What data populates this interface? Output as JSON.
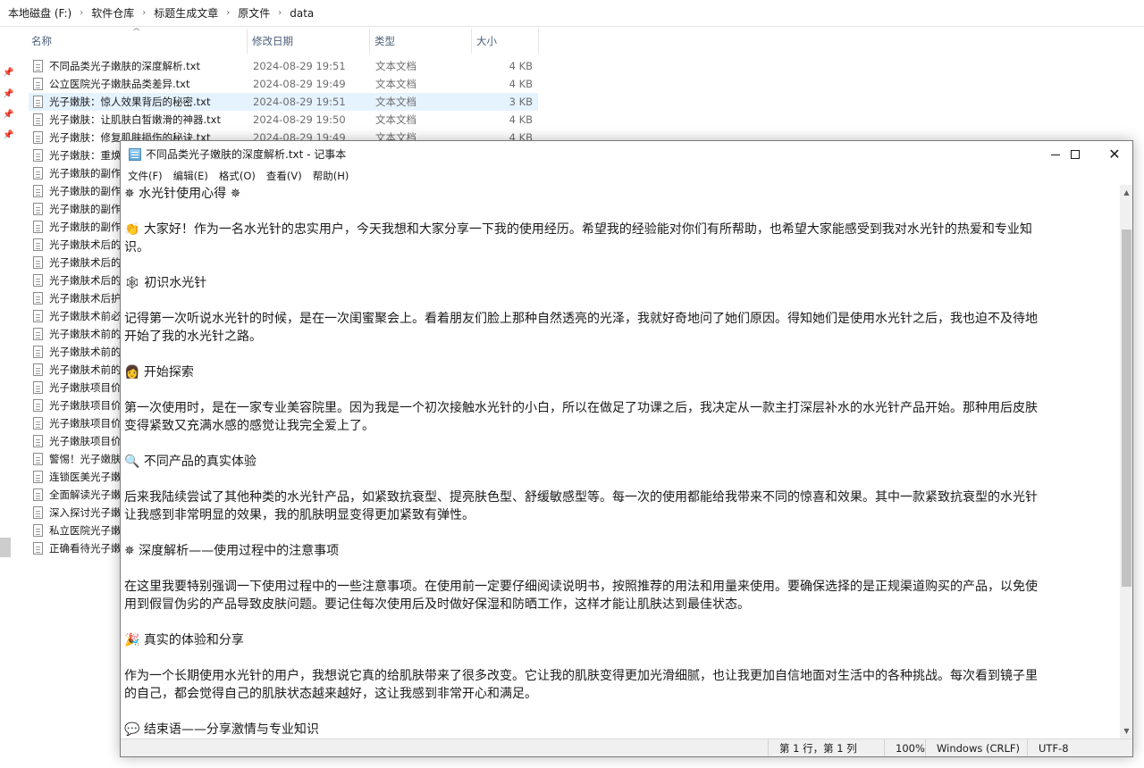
{
  "explorer": {
    "breadcrumb": [
      "本地磁盘 (F:)",
      "软件仓库",
      "标题生成文章",
      "原文件",
      "data"
    ],
    "breadcrumb_separator": "›",
    "columns": {
      "name": "名称",
      "date": "修改日期",
      "type": "类型",
      "size": "大小"
    },
    "files": [
      {
        "name": "不同品类光子嫩肤的深度解析.txt",
        "date": "2024-08-29 19:51",
        "type": "文本文档",
        "size": "4 KB"
      },
      {
        "name": "公立医院光子嫩肤品类差异.txt",
        "date": "2024-08-29 19:49",
        "type": "文本文档",
        "size": "4 KB"
      },
      {
        "name": "光子嫩肤：惊人效果背后的秘密.txt",
        "date": "2024-08-29 19:51",
        "type": "文本文档",
        "size": "3 KB"
      },
      {
        "name": "光子嫩肤：让肌肤白皙嫩滑的神器.txt",
        "date": "2024-08-29 19:50",
        "type": "文本文档",
        "size": "4 KB"
      },
      {
        "name": "光子嫩肤：修复肌肤损伤的秘诀.txt",
        "date": "2024-08-29 19:49",
        "type": "文本文档",
        "size": "4 KB"
      },
      {
        "name": "光子嫩肤：重焕",
        "date": "",
        "type": "",
        "size": ""
      },
      {
        "name": "光子嫩肤的副作",
        "date": "",
        "type": "",
        "size": ""
      },
      {
        "name": "光子嫩肤的副作",
        "date": "",
        "type": "",
        "size": ""
      },
      {
        "name": "光子嫩肤的副作",
        "date": "",
        "type": "",
        "size": ""
      },
      {
        "name": "光子嫩肤的副作",
        "date": "",
        "type": "",
        "size": ""
      },
      {
        "name": "光子嫩肤术后的",
        "date": "",
        "type": "",
        "size": ""
      },
      {
        "name": "光子嫩肤术后的",
        "date": "",
        "type": "",
        "size": ""
      },
      {
        "name": "光子嫩肤术后的",
        "date": "",
        "type": "",
        "size": ""
      },
      {
        "name": "光子嫩肤术后护",
        "date": "",
        "type": "",
        "size": ""
      },
      {
        "name": "光子嫩肤术前必",
        "date": "",
        "type": "",
        "size": ""
      },
      {
        "name": "光子嫩肤术前的",
        "date": "",
        "type": "",
        "size": ""
      },
      {
        "name": "光子嫩肤术前的",
        "date": "",
        "type": "",
        "size": ""
      },
      {
        "name": "光子嫩肤术前的",
        "date": "",
        "type": "",
        "size": ""
      },
      {
        "name": "光子嫩肤项目价",
        "date": "",
        "type": "",
        "size": ""
      },
      {
        "name": "光子嫩肤项目价",
        "date": "",
        "type": "",
        "size": ""
      },
      {
        "name": "光子嫩肤项目价",
        "date": "",
        "type": "",
        "size": ""
      },
      {
        "name": "光子嫩肤项目价",
        "date": "",
        "type": "",
        "size": ""
      },
      {
        "name": "警惕！光子嫩肤",
        "date": "",
        "type": "",
        "size": ""
      },
      {
        "name": "连锁医美光子嫩",
        "date": "",
        "type": "",
        "size": ""
      },
      {
        "name": "全面解读光子嫩",
        "date": "",
        "type": "",
        "size": ""
      },
      {
        "name": "深入探讨光子嫩",
        "date": "",
        "type": "",
        "size": ""
      },
      {
        "name": "私立医院光子嫩",
        "date": "",
        "type": "",
        "size": ""
      },
      {
        "name": "正确看待光子嫩",
        "date": "",
        "type": "",
        "size": ""
      }
    ]
  },
  "notepad": {
    "title": "不同品类光子嫩肤的深度解析.txt - 记事本",
    "menu": [
      "文件(F)",
      "编辑(E)",
      "格式(O)",
      "查看(V)",
      "帮助(H)"
    ],
    "lines": [
      "✵ 水光针使用心得 ✵",
      "",
      "👏 大家好！作为一名水光针的忠实用户，今天我想和大家分享一下我的使用经历。希望我的经验能对你们有所帮助，也希望大家能感受到我对水光针的热爱和专业知",
      "识。",
      "",
      "🕸 初识水光针",
      "",
      "记得第一次听说水光针的时候，是在一次闺蜜聚会上。看着朋友们脸上那种自然透亮的光泽，我就好奇地问了她们原因。得知她们是使用水光针之后，我也迫不及待地",
      "开始了我的水光针之路。",
      "",
      "👩 开始探索",
      "",
      "第一次使用时，是在一家专业美容院里。因为我是一个初次接触水光针的小白，所以在做足了功课之后，我决定从一款主打深层补水的水光针产品开始。那种用后皮肤",
      "变得紧致又充满水感的感觉让我完全爱上了。",
      "",
      "🔍 不同产品的真实体验",
      "",
      "后来我陆续尝试了其他种类的水光针产品，如紧致抗衰型、提亮肤色型、舒缓敏感型等。每一次的使用都能给我带来不同的惊喜和效果。其中一款紧致抗衰型的水光针",
      "让我感到非常明显的效果，我的肌肤明显变得更加紧致有弹性。",
      "",
      "✵ 深度解析——使用过程中的注意事项",
      "",
      "在这里我要特别强调一下使用过程中的一些注意事项。在使用前一定要仔细阅读说明书，按照推荐的用法和用量来使用。要确保选择的是正规渠道购买的产品，以免使",
      "用到假冒伪劣的产品导致皮肤问题。要记住每次使用后及时做好保湿和防晒工作，这样才能让肌肤达到最佳状态。",
      "",
      "🎉 真实的体验和分享",
      "",
      "作为一个长期使用水光针的用户，我想说它真的给肌肤带来了很多改变。它让我的肌肤变得更加光滑细腻，也让我更加自信地面对生活中的各种挑战。每次看到镜子里",
      "的自己，都会觉得自己的肌肤状态越来越好，这让我感到非常开心和满足。",
      "",
      "💬 结束语——分享激情与专业知识"
    ],
    "status": {
      "position": "第 1 行，第 1 列",
      "zoom": "100%",
      "line_ending": "Windows (CRLF)",
      "encoding": "UTF-8"
    }
  }
}
